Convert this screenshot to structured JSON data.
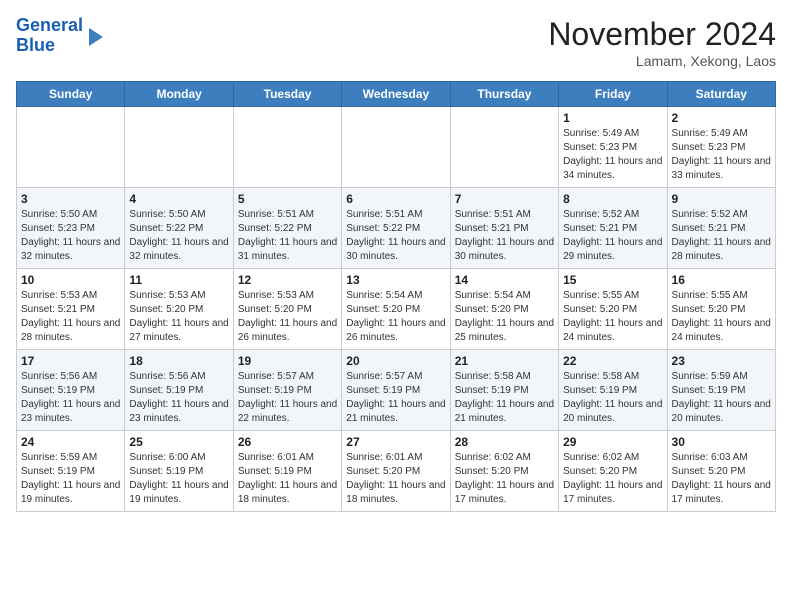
{
  "header": {
    "logo_line1": "General",
    "logo_line2": "Blue",
    "month_title": "November 2024",
    "location": "Lamam, Xekong, Laos"
  },
  "calendar": {
    "days_of_week": [
      "Sunday",
      "Monday",
      "Tuesday",
      "Wednesday",
      "Thursday",
      "Friday",
      "Saturday"
    ],
    "weeks": [
      [
        {
          "day": "",
          "info": ""
        },
        {
          "day": "",
          "info": ""
        },
        {
          "day": "",
          "info": ""
        },
        {
          "day": "",
          "info": ""
        },
        {
          "day": "",
          "info": ""
        },
        {
          "day": "1",
          "info": "Sunrise: 5:49 AM\nSunset: 5:23 PM\nDaylight: 11 hours and 34 minutes."
        },
        {
          "day": "2",
          "info": "Sunrise: 5:49 AM\nSunset: 5:23 PM\nDaylight: 11 hours and 33 minutes."
        }
      ],
      [
        {
          "day": "3",
          "info": "Sunrise: 5:50 AM\nSunset: 5:23 PM\nDaylight: 11 hours and 32 minutes."
        },
        {
          "day": "4",
          "info": "Sunrise: 5:50 AM\nSunset: 5:22 PM\nDaylight: 11 hours and 32 minutes."
        },
        {
          "day": "5",
          "info": "Sunrise: 5:51 AM\nSunset: 5:22 PM\nDaylight: 11 hours and 31 minutes."
        },
        {
          "day": "6",
          "info": "Sunrise: 5:51 AM\nSunset: 5:22 PM\nDaylight: 11 hours and 30 minutes."
        },
        {
          "day": "7",
          "info": "Sunrise: 5:51 AM\nSunset: 5:21 PM\nDaylight: 11 hours and 30 minutes."
        },
        {
          "day": "8",
          "info": "Sunrise: 5:52 AM\nSunset: 5:21 PM\nDaylight: 11 hours and 29 minutes."
        },
        {
          "day": "9",
          "info": "Sunrise: 5:52 AM\nSunset: 5:21 PM\nDaylight: 11 hours and 28 minutes."
        }
      ],
      [
        {
          "day": "10",
          "info": "Sunrise: 5:53 AM\nSunset: 5:21 PM\nDaylight: 11 hours and 28 minutes."
        },
        {
          "day": "11",
          "info": "Sunrise: 5:53 AM\nSunset: 5:20 PM\nDaylight: 11 hours and 27 minutes."
        },
        {
          "day": "12",
          "info": "Sunrise: 5:53 AM\nSunset: 5:20 PM\nDaylight: 11 hours and 26 minutes."
        },
        {
          "day": "13",
          "info": "Sunrise: 5:54 AM\nSunset: 5:20 PM\nDaylight: 11 hours and 26 minutes."
        },
        {
          "day": "14",
          "info": "Sunrise: 5:54 AM\nSunset: 5:20 PM\nDaylight: 11 hours and 25 minutes."
        },
        {
          "day": "15",
          "info": "Sunrise: 5:55 AM\nSunset: 5:20 PM\nDaylight: 11 hours and 24 minutes."
        },
        {
          "day": "16",
          "info": "Sunrise: 5:55 AM\nSunset: 5:20 PM\nDaylight: 11 hours and 24 minutes."
        }
      ],
      [
        {
          "day": "17",
          "info": "Sunrise: 5:56 AM\nSunset: 5:19 PM\nDaylight: 11 hours and 23 minutes."
        },
        {
          "day": "18",
          "info": "Sunrise: 5:56 AM\nSunset: 5:19 PM\nDaylight: 11 hours and 23 minutes."
        },
        {
          "day": "19",
          "info": "Sunrise: 5:57 AM\nSunset: 5:19 PM\nDaylight: 11 hours and 22 minutes."
        },
        {
          "day": "20",
          "info": "Sunrise: 5:57 AM\nSunset: 5:19 PM\nDaylight: 11 hours and 21 minutes."
        },
        {
          "day": "21",
          "info": "Sunrise: 5:58 AM\nSunset: 5:19 PM\nDaylight: 11 hours and 21 minutes."
        },
        {
          "day": "22",
          "info": "Sunrise: 5:58 AM\nSunset: 5:19 PM\nDaylight: 11 hours and 20 minutes."
        },
        {
          "day": "23",
          "info": "Sunrise: 5:59 AM\nSunset: 5:19 PM\nDaylight: 11 hours and 20 minutes."
        }
      ],
      [
        {
          "day": "24",
          "info": "Sunrise: 5:59 AM\nSunset: 5:19 PM\nDaylight: 11 hours and 19 minutes."
        },
        {
          "day": "25",
          "info": "Sunrise: 6:00 AM\nSunset: 5:19 PM\nDaylight: 11 hours and 19 minutes."
        },
        {
          "day": "26",
          "info": "Sunrise: 6:01 AM\nSunset: 5:19 PM\nDaylight: 11 hours and 18 minutes."
        },
        {
          "day": "27",
          "info": "Sunrise: 6:01 AM\nSunset: 5:20 PM\nDaylight: 11 hours and 18 minutes."
        },
        {
          "day": "28",
          "info": "Sunrise: 6:02 AM\nSunset: 5:20 PM\nDaylight: 11 hours and 17 minutes."
        },
        {
          "day": "29",
          "info": "Sunrise: 6:02 AM\nSunset: 5:20 PM\nDaylight: 11 hours and 17 minutes."
        },
        {
          "day": "30",
          "info": "Sunrise: 6:03 AM\nSunset: 5:20 PM\nDaylight: 11 hours and 17 minutes."
        }
      ]
    ]
  }
}
